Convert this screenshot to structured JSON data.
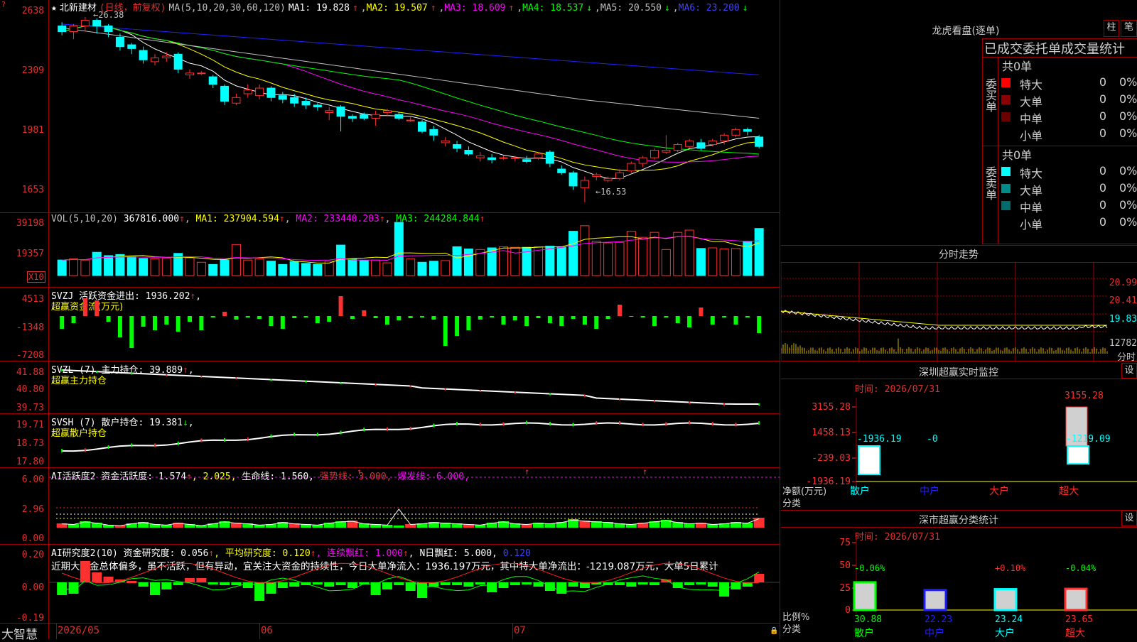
{
  "app": {
    "brand": "大智慧"
  },
  "kline": {
    "stock_title": "北新建材",
    "period_label": "(日线，前复权)",
    "ma_params": "MA(5,10,20,30,60,120)",
    "ma1": "MA1: 19.828",
    "ma2": "MA2: 19.507",
    "ma3": "MA3: 18.609",
    "ma4": "MA4: 18.537",
    "ma5": "MA5: 20.550",
    "ma6": "MA6: 23.200",
    "high_marker": "26.38",
    "low_marker": "←16.53",
    "y_ticks": [
      "2638",
      "2309",
      "1981",
      "1653"
    ]
  },
  "vol": {
    "header": "VOL(5,10,20)",
    "value": "367816.000",
    "ma1": "MA1: 237904.594",
    "ma2": "MA2: 233440.203",
    "ma3": "MA3: 244284.844",
    "y_ticks": [
      "39198",
      "19357"
    ],
    "unit": "X10"
  },
  "svzj": {
    "header": "SVZJ  活跃资金进出: 1936.202",
    "sub": "超赢资金流(万元)",
    "y_ticks": [
      "4513",
      "-1348",
      "-7208"
    ]
  },
  "svzl": {
    "header": "SVZL (7) 主力持仓: 39.889",
    "sub": "超赢主力持仓",
    "y_ticks": [
      "41.88",
      "40.80",
      "39.73"
    ]
  },
  "svsh": {
    "header": "SVSH (7) 散户持仓: 19.381",
    "sub": "超赢散户持仓",
    "y_ticks": [
      "19.71",
      "18.73",
      "17.80"
    ]
  },
  "ai1": {
    "header": "AI活跃度2 资金活跃度: 1.574",
    "v2": ", 2.025,",
    "life": "生命线: 1.560,",
    "strong": "强势线: 3.000,",
    "burst": "爆发线: 6.000,",
    "y_ticks": [
      "6.00",
      "2.96",
      "0.00"
    ]
  },
  "ai2": {
    "header": "AI研究度2(10) 资金研究度: 0.056",
    "avg": ", 平均研究度: 0.120",
    "red": ", 连续飘红: 1.000",
    "nred": ", N日飘红: 5.000,",
    "last": " 0.120",
    "comment": "近期大资金总体偏多，虽不活跃，但有异动，宜关注大资金的持续性，今日大单净流入：1936.197万元，其中特大单净流出：-1219.087万元，大单5日累计",
    "y_ticks": [
      "0.20",
      "0.00",
      "-0.19"
    ]
  },
  "x_axis": {
    "labels": [
      "2026/05",
      "06",
      "07"
    ]
  },
  "longhu": {
    "title": "龙虎看盘(逐单)",
    "btn_zhu": "柱",
    "btn_bi": "笔",
    "stats_title": "已成交委托单成交量统计",
    "buy_label": "委买单",
    "sell_label": "委卖单",
    "buy_total": "共0单",
    "sell_total": "共0单",
    "buy_rows": [
      {
        "name": "特大",
        "count": "0",
        "pct": "0%",
        "color": "#ff0000"
      },
      {
        "name": "大单",
        "count": "0",
        "pct": "0%",
        "color": "#8b0000"
      },
      {
        "name": "中单",
        "count": "0",
        "pct": "0%",
        "color": "#6b0000"
      },
      {
        "name": "小单",
        "count": "0",
        "pct": "0%",
        "color": "#000000"
      }
    ],
    "sell_rows": [
      {
        "name": "特大",
        "count": "0",
        "pct": "0%",
        "color": "#00ffff"
      },
      {
        "name": "大单",
        "count": "0",
        "pct": "0%",
        "color": "#008b8b"
      },
      {
        "name": "中单",
        "count": "0",
        "pct": "0%",
        "color": "#006b6b"
      },
      {
        "name": "小单",
        "count": "0",
        "pct": "0%",
        "color": "#000000"
      }
    ]
  },
  "fenshi": {
    "title": "分时走势",
    "y_ticks": [
      "20.99",
      "20.41",
      "19.83",
      "12782"
    ],
    "unit": "分时"
  },
  "monitor": {
    "title": "深圳超赢实时监控",
    "set": "设",
    "time": "时间: 2026/07/31",
    "y_ticks": [
      "3155.28",
      "1458.13",
      "-239.03",
      "-1936.19"
    ],
    "left_label": "净额(万元)",
    "left_label2": "分类",
    "categories": [
      "散户",
      "中户",
      "大户",
      "超大"
    ],
    "values": [
      "-1936.19",
      "-0",
      "3155.28",
      "-1219.09"
    ]
  },
  "classstat": {
    "title": "深市超赢分类统计",
    "set": "设",
    "time": "时间: 2026/07/31",
    "y_ticks": [
      "75",
      "50",
      "25",
      "0"
    ],
    "left_label": "比例%",
    "left_label2": "分类",
    "categories": [
      "散户",
      "中户",
      "大户",
      "超大"
    ],
    "ratios": [
      "30.88",
      "22.23",
      "23.24",
      "23.65"
    ],
    "changes": [
      "-0.06%",
      "",
      "+0.10%",
      "-0.04%"
    ]
  },
  "chart_data": [
    {
      "type": "candlestick",
      "title": "北新建材(日线，前复权)",
      "x": [
        "2026/05",
        "06",
        "07"
      ],
      "ylim": [
        16.53,
        26.38
      ],
      "series": [
        {
          "name": "MA1",
          "last": 19.828
        },
        {
          "name": "MA2",
          "last": 19.507
        },
        {
          "name": "MA3",
          "last": 18.609
        },
        {
          "name": "MA4",
          "last": 18.537
        },
        {
          "name": "MA5",
          "last": 20.55
        },
        {
          "name": "MA6",
          "last": 23.2
        }
      ],
      "candles": [
        [
          25.9,
          25.6,
          26.1,
          25.4
        ],
        [
          25.6,
          25.9,
          26.0,
          25.2
        ],
        [
          25.9,
          26.2,
          26.38,
          25.6
        ],
        [
          26.2,
          25.9,
          26.3,
          25.5
        ],
        [
          25.9,
          25.6,
          26.0,
          25.3
        ],
        [
          25.3,
          24.8,
          25.5,
          24.6
        ],
        [
          24.9,
          24.7,
          25.0,
          24.4
        ],
        [
          24.6,
          24.1,
          24.8,
          23.9
        ],
        [
          24.0,
          24.2,
          24.4,
          23.8
        ],
        [
          24.2,
          24.3,
          24.5,
          24.0
        ],
        [
          24.4,
          23.6,
          24.5,
          23.4
        ],
        [
          23.3,
          23.4,
          23.6,
          23.1
        ],
        [
          23.4,
          23.4,
          23.5,
          23.3
        ],
        [
          23.2,
          22.8,
          23.3,
          22.6
        ],
        [
          22.7,
          21.9,
          22.8,
          21.7
        ],
        [
          21.8,
          22.1,
          22.3,
          21.7
        ],
        [
          22.3,
          22.5,
          22.8,
          22.1
        ],
        [
          22.2,
          22.6,
          22.8,
          22.0
        ],
        [
          22.6,
          22.1,
          22.7,
          21.9
        ],
        [
          22.2,
          22.0,
          22.4,
          21.8
        ],
        [
          22.1,
          21.8,
          22.3,
          21.6
        ],
        [
          21.9,
          21.7,
          22.1,
          21.5
        ],
        [
          21.7,
          21.6,
          21.8,
          21.4
        ],
        [
          21.3,
          21.4,
          21.6,
          20.9
        ],
        [
          21.6,
          21.1,
          21.7,
          20.3
        ],
        [
          21.1,
          21.0,
          21.2,
          20.8
        ],
        [
          21.2,
          21.0,
          21.3,
          20.9
        ],
        [
          21.0,
          21.2,
          21.4,
          20.6
        ],
        [
          21.3,
          21.4,
          21.5,
          21.1
        ],
        [
          21.2,
          21.0,
          21.3,
          20.9
        ],
        [
          20.9,
          20.9,
          21.1,
          20.8
        ],
        [
          20.8,
          20.3,
          20.9,
          20.2
        ],
        [
          20.4,
          20.1,
          20.6,
          19.8
        ],
        [
          19.7,
          19.8,
          20.0,
          19.5
        ],
        [
          19.6,
          19.4,
          19.8,
          19.2
        ],
        [
          19.3,
          19.1,
          19.5,
          19.0
        ],
        [
          18.9,
          19.0,
          19.2,
          18.7
        ],
        [
          18.9,
          18.8,
          19.1,
          18.6
        ],
        [
          18.9,
          18.9,
          19.0,
          18.8
        ],
        [
          18.9,
          18.9,
          19.0,
          18.7
        ],
        [
          18.8,
          18.7,
          19.0,
          18.6
        ],
        [
          18.9,
          19.1,
          19.2,
          18.8
        ],
        [
          19.2,
          18.6,
          19.3,
          18.4
        ],
        [
          18.3,
          18.1,
          18.5,
          18.0
        ],
        [
          18.1,
          17.4,
          18.2,
          17.2
        ],
        [
          17.3,
          17.7,
          17.9,
          16.53
        ],
        [
          17.9,
          18.0,
          18.1,
          17.7
        ],
        [
          17.7,
          17.8,
          17.9,
          17.6
        ],
        [
          17.8,
          18.1,
          18.3,
          17.7
        ],
        [
          18.2,
          18.6,
          18.7,
          18.1
        ],
        [
          18.6,
          18.9,
          19.0,
          18.4
        ],
        [
          18.9,
          19.3,
          19.4,
          18.8
        ],
        [
          19.2,
          19.3,
          20.1,
          19.1
        ],
        [
          19.3,
          19.6,
          19.7,
          19.2
        ],
        [
          19.5,
          19.8,
          19.9,
          19.4
        ],
        [
          19.7,
          19.4,
          19.9,
          19.3
        ],
        [
          19.6,
          19.8,
          19.9,
          19.5
        ],
        [
          19.8,
          20.1,
          20.2,
          19.6
        ],
        [
          20.1,
          20.4,
          20.5,
          20.0
        ],
        [
          20.4,
          20.3,
          20.5,
          20.1
        ],
        [
          20.0,
          19.5,
          20.1,
          19.4
        ]
      ]
    },
    {
      "type": "bar",
      "title": "VOL(5,10,20)",
      "series": [
        {
          "name": "MA1",
          "last": 237904.594
        },
        {
          "name": "MA2",
          "last": 233440.203
        },
        {
          "name": "MA3",
          "last": 244284.844
        }
      ],
      "last": 367816.0
    }
  ]
}
